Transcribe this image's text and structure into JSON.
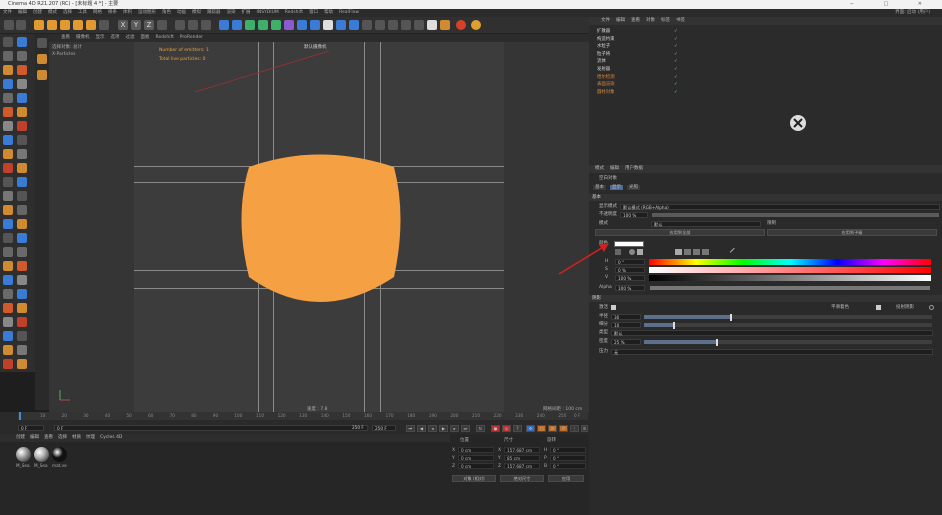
{
  "window": {
    "title": "Cinema 4D R21.207 (RC) - [未标题 4 *] - 主要",
    "controls": "− □ ✕"
  },
  "menubar": {
    "items": [
      "文件",
      "编辑",
      "创建",
      "模式",
      "选择",
      "工具",
      "网格",
      "样条",
      "体积",
      "运动图形",
      "角色",
      "动画",
      "模拟",
      "跟踪器",
      "渲染",
      "扩展",
      "INSYDIUM",
      "Redshift",
      "窗口",
      "帮助",
      "RealFlow"
    ],
    "right": "界面: 启动 (用户)"
  },
  "toolbar": {
    "xyz": [
      "X",
      "Y",
      "Z"
    ]
  },
  "viewport": {
    "menu": [
      "查看",
      "摄像机",
      "显示",
      "选项",
      "过滤",
      "面板",
      "Redshift",
      "ProRender"
    ],
    "camera": "默认摄像机",
    "info_selected": "选择对象: 总计",
    "info_count": "X-Particles",
    "hud_emitters": "Number of emitters: 1",
    "hud_particles": "Total live particles: 0",
    "grid_spacing": "网格间距 : 100 cm",
    "speed": "速度 : 7.8"
  },
  "timeline": {
    "ticks": [
      "10",
      "20",
      "30",
      "40",
      "50",
      "60",
      "70",
      "80",
      "90",
      "100",
      "110",
      "120",
      "130",
      "140",
      "150",
      "160",
      "170",
      "180",
      "190",
      "200",
      "210",
      "220",
      "230",
      "240",
      "250"
    ],
    "start": "0 F",
    "current": "0 F",
    "end": "250 F",
    "end2": "250 F",
    "frame_right": "0 F"
  },
  "material_panel": {
    "tabs": [
      "创建",
      "编辑",
      "查看",
      "选择",
      "材质",
      "纹理",
      "Cycles 4D"
    ],
    "materials": [
      {
        "label": "M_Sea",
        "color": "#9a9a9a"
      },
      {
        "label": "M_Sea",
        "color": "#b0b0b0"
      },
      {
        "label": "mat.ve",
        "color": "#111111"
      }
    ]
  },
  "coords": {
    "headers": [
      "位置",
      "尺寸",
      "旋转"
    ],
    "pos": [
      {
        "axis": "X",
        "val": "0 cm"
      },
      {
        "axis": "Y",
        "val": "0 cm"
      },
      {
        "axis": "Z",
        "val": "0 cm"
      }
    ],
    "size": [
      {
        "axis": "X",
        "val": "157.687 cm"
      },
      {
        "axis": "Y",
        "val": "85 cm"
      },
      {
        "axis": "Z",
        "val": "157.687 cm"
      }
    ],
    "rot": [
      {
        "axis": "H",
        "val": "0 °"
      },
      {
        "axis": "P",
        "val": "0 °"
      },
      {
        "axis": "B",
        "val": "0 °"
      }
    ],
    "mode": "对象 (相对)",
    "size_mode": "绝对尺寸",
    "apply": "应用"
  },
  "object_manager": {
    "tabs": [
      "文件",
      "编辑",
      "查看",
      "对象",
      "标签",
      "书签"
    ],
    "rows": [
      {
        "name": "扩散器",
        "color": "#d7d7d7"
      },
      {
        "name": "构造约束",
        "color": "#d7d7d7"
      },
      {
        "name": "水粒子",
        "color": "#d7d7d7"
      },
      {
        "name": "粒子将",
        "color": "#d7d7d7"
      },
      {
        "name": "流体",
        "color": "#d7d7d7"
      },
      {
        "name": "发射器",
        "color": "#d7d7d7"
      },
      {
        "name": "哈尔检测",
        "color": "#e08a3a"
      },
      {
        "name": "表面渲染",
        "color": "#e08a3a"
      },
      {
        "name": "圆柱对象",
        "color": "#e08a3a"
      }
    ]
  },
  "attributes": {
    "bar": [
      "模式",
      "编辑",
      "用户数据"
    ],
    "object_name": "空白对象",
    "tabs": [
      "基本",
      "显示",
      "光照"
    ],
    "section_basic": "基本",
    "mode_label": "显示模式",
    "mode_value": "默认模式 (RGB+Alpha)",
    "opacity_label": "不透明度",
    "opacity_value": "100 %",
    "style_label": "模式",
    "style_value": "默认",
    "limit_label": "限制",
    "btn_a": "应用到全部",
    "btn_b": "应用到子级",
    "color_label": "颜色",
    "h_label": "H",
    "h_value": "0 °",
    "s_label": "S",
    "s_value": "0 %",
    "v_label": "V",
    "v_value": "100 %",
    "alpha_label": "Alpha",
    "alpha_value": "100 %",
    "section_shade": "阴影",
    "check_a": "激活",
    "check_b": "平滑着色",
    "check_c": "投射阴影",
    "r1_label": "半径",
    "r1_value": "30",
    "r2_label": "细分",
    "r2_value": "10",
    "type_label": "类型",
    "type_value": "默认",
    "density_label": "密度",
    "density_value": "25 %",
    "pressure_label": "压力",
    "pressure_value": "无"
  },
  "colors": {
    "accent": "#f5a042",
    "arrow": "#d02020"
  },
  "levels": {
    "r1": 0.3,
    "r2": 0.1,
    "density": 0.25
  }
}
